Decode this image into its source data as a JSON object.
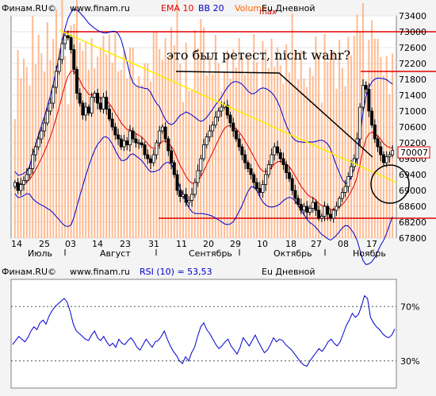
{
  "main_panel": {
    "header": {
      "source": "Финам.RU©",
      "site": "www.finam.ru",
      "ema": "EMA 10",
      "bb": "BB 20",
      "volume": "Volume",
      "max": "max",
      "instrument": "Eu Дневной",
      "colors": {
        "ema": "#e00000",
        "bb": "#0000cc",
        "volume": "#ff6600",
        "max": "#cc0000",
        "instrument": "#000000"
      }
    },
    "annotation": "это был ретест, nicht wahr?",
    "last_price_label": "70007"
  },
  "rsi_panel": {
    "header": {
      "source": "Финам.RU©",
      "site": "www.finam.ru",
      "indicator": "RSI (10) = 53,53",
      "instrument": "Eu Дневной"
    }
  },
  "chart_data": [
    {
      "type": "candlestick",
      "instrument": "Eu Дневной",
      "y_ticks": [
        73400,
        73000,
        72600,
        72200,
        71800,
        71400,
        71000,
        70600,
        70200,
        69800,
        69400,
        69000,
        68600,
        68200,
        67800
      ],
      "ylim": [
        67800,
        73400
      ],
      "x_ticks": [
        "14",
        "25",
        "03",
        "14",
        "23",
        "31",
        "11",
        "20",
        "29",
        "10",
        "18",
        "27",
        "08",
        "17"
      ],
      "months": [
        "Июль",
        "Август",
        "Сентябрь",
        "Октябрь",
        "Ноябрь"
      ],
      "horizontal_lines": [
        73000,
        72000,
        68300
      ],
      "overlays": [
        "EMA 10",
        "BB 20",
        "Volume"
      ],
      "colors": {
        "bullish": "#ffffff",
        "bearish": "#000000",
        "ema": "#e00000",
        "bb": "#0000cc",
        "volume": "#ffaa77",
        "resistance": "#e00000",
        "trend": "#ffee00"
      },
      "closes": [
        69200,
        69000,
        69150,
        69250,
        69400,
        69550,
        69900,
        70100,
        70300,
        70500,
        70700,
        71000,
        71200,
        71600,
        72000,
        72300,
        72700,
        72900,
        72850,
        72550,
        72050,
        71450,
        71200,
        70900,
        71100,
        70950,
        71350,
        71450,
        71200,
        71050,
        71350,
        71050,
        70800,
        70600,
        70400,
        70300,
        70100,
        70250,
        70150,
        70500,
        70300,
        70200,
        70200,
        70150,
        69900,
        69800,
        69700,
        69900,
        70200,
        70500,
        70600,
        70300,
        70000,
        69700,
        69400,
        69000,
        68850,
        68900,
        68700,
        68750,
        68900,
        69200,
        69500,
        69800,
        70150,
        70350,
        70500,
        70650,
        70850,
        71000,
        71100,
        71150,
        70900,
        70700,
        70500,
        70300,
        70100,
        69900,
        69700,
        69550,
        69400,
        69200,
        69050,
        68950,
        69150,
        69400,
        69650,
        69900,
        70100,
        69950,
        69800,
        69650,
        69450,
        69300,
        69000,
        68800,
        68650,
        68500,
        68600,
        68450,
        68550,
        68700,
        68500,
        68300,
        68350,
        68600,
        68400,
        68300,
        68500,
        68600,
        68800,
        68950,
        69100,
        69350,
        69600,
        69800,
        70300,
        71100,
        71650,
        71550,
        71000,
        70650,
        70300,
        70100,
        69900,
        69700,
        69850,
        69900,
        70007
      ]
    },
    {
      "type": "line",
      "indicator": "RSI (10)",
      "value_text": "53,53",
      "y_ticks": [
        "70%",
        "30%"
      ],
      "reference_levels": [
        70,
        30
      ],
      "ylim": [
        10,
        90
      ],
      "color": "#0000cc",
      "values": [
        42,
        45,
        48,
        46,
        44,
        47,
        52,
        55,
        53,
        58,
        60,
        57,
        63,
        67,
        70,
        72,
        74,
        76,
        73,
        66,
        57,
        52,
        50,
        48,
        46,
        45,
        49,
        52,
        47,
        45,
        48,
        44,
        41,
        43,
        40,
        46,
        43,
        42,
        45,
        47,
        44,
        40,
        38,
        42,
        46,
        43,
        40,
        44,
        45,
        48,
        52,
        46,
        41,
        37,
        34,
        30,
        28,
        33,
        30,
        36,
        40,
        48,
        55,
        58,
        53,
        50,
        46,
        42,
        39,
        41,
        44,
        46,
        41,
        38,
        35,
        40,
        47,
        44,
        41,
        45,
        49,
        44,
        40,
        36,
        38,
        42,
        47,
        44,
        46,
        45,
        42,
        40,
        38,
        35,
        32,
        29,
        27,
        26,
        30,
        33,
        36,
        39,
        37,
        40,
        44,
        46,
        43,
        41,
        44,
        50,
        56,
        60,
        65,
        62,
        64,
        70,
        78,
        76,
        62,
        58,
        55,
        53,
        50,
        48,
        47,
        49,
        53.53
      ]
    }
  ]
}
